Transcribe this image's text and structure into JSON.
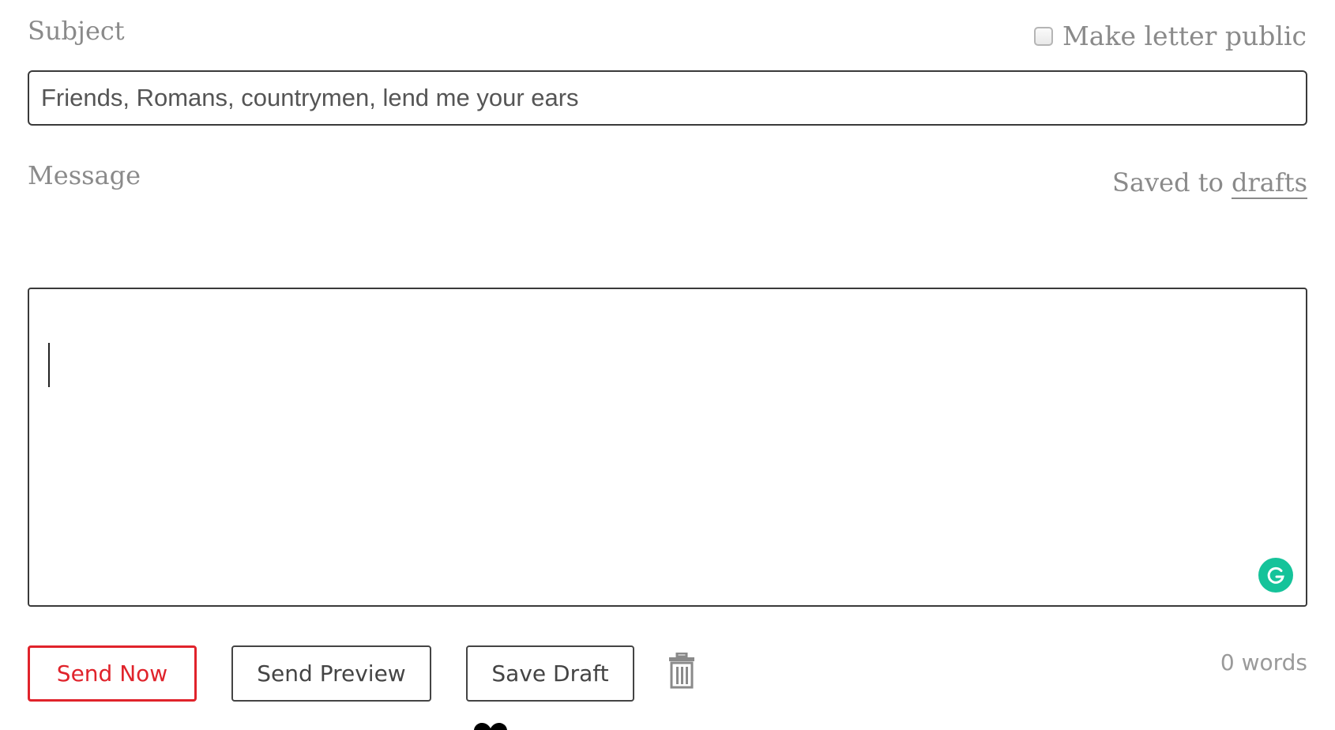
{
  "subject": {
    "label": "Subject",
    "value": "Friends, Romans, countrymen, lend me your ears"
  },
  "public_option": {
    "label": "Make letter public",
    "checked": false
  },
  "message": {
    "label": "Message",
    "value": ""
  },
  "save_status": {
    "prefix": "Saved to ",
    "link_text": "drafts"
  },
  "actions": {
    "send_now": "Send Now",
    "send_preview": "Send Preview",
    "save_draft": "Save Draft"
  },
  "word_count": "0 words",
  "icons": {
    "trash": "trash-icon",
    "grammarly": "grammarly-icon",
    "heart": "heart-icon"
  },
  "colors": {
    "accent": "#e0232b",
    "grammarly": "#15c39a",
    "label": "#8a8a8a",
    "border": "#3a3a3a"
  }
}
